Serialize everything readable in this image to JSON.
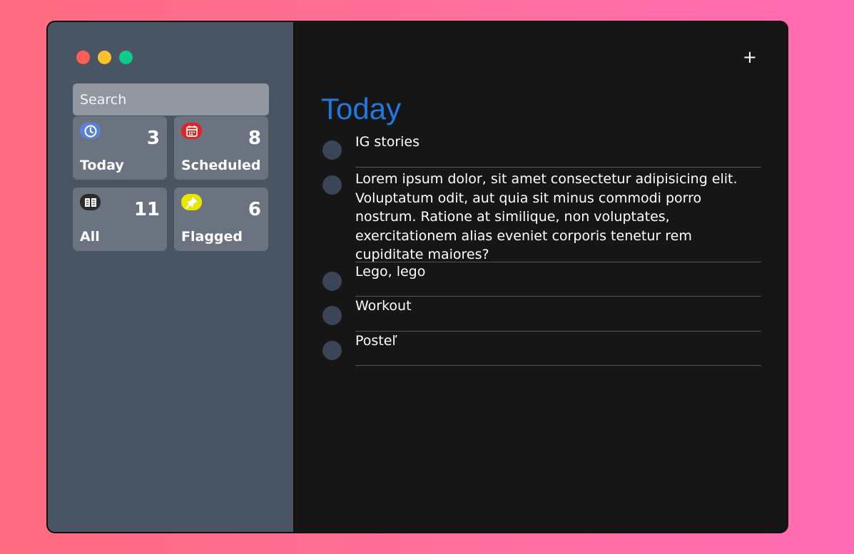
{
  "sidebar": {
    "search_placeholder": "Search",
    "tiles": [
      {
        "label": "Today",
        "count": "3",
        "icon": "clock-icon",
        "icon_color": "#5b82d6"
      },
      {
        "label": "Scheduled",
        "count": "8",
        "icon": "calendar-icon",
        "icon_color": "#e02424"
      },
      {
        "label": "All",
        "count": "11",
        "icon": "inbox-icon",
        "icon_color": "#2b2b2b"
      },
      {
        "label": "Flagged",
        "count": "6",
        "icon": "pin-icon",
        "icon_color": "#e6e600"
      }
    ]
  },
  "main": {
    "add_label": "+",
    "title": "Today",
    "title_color": "#1f7ae0",
    "items": [
      "IG stories",
      "Lorem ipsum dolor, sit amet consectetur adipisicing elit. Voluptatum odit, aut quia sit minus commodi porro nostrum. Ratione at similique, non voluptates, exercitationem alias eveniet corporis tenetur rem cupiditate maiores?",
      "Lego, lego",
      "Workout",
      "Posteľ"
    ]
  }
}
